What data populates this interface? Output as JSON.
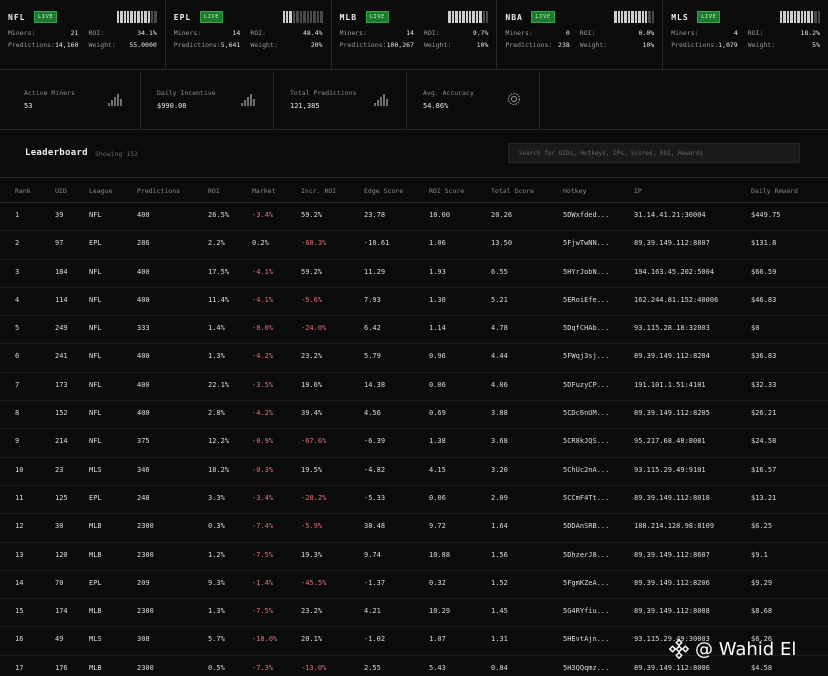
{
  "leagues": [
    {
      "name": "NFL",
      "live": "LIVE",
      "bars_filled": 10,
      "miners_label": "Miners:",
      "miners": "21",
      "roi_label": "ROI:",
      "roi": "34.1%",
      "pred_label": "Predictions:",
      "predictions": "14,160",
      "weight_label": "Weight:",
      "weight": "55.0000"
    },
    {
      "name": "EPL",
      "live": "LIVE",
      "bars_filled": 3,
      "miners_label": "Miners:",
      "miners": "14",
      "roi_label": "ROI:",
      "roi": "48.4%",
      "pred_label": "Predictions:",
      "predictions": "5,641",
      "weight_label": "Weight:",
      "weight": "20%"
    },
    {
      "name": "MLB",
      "live": "LIVE",
      "bars_filled": 10,
      "miners_label": "Miners:",
      "miners": "14",
      "roi_label": "ROI:",
      "roi": "9.7%",
      "pred_label": "Predictions:",
      "predictions": "100,267",
      "weight_label": "Weight:",
      "weight": "10%"
    },
    {
      "name": "NBA",
      "live": "LIVE",
      "bars_filled": 10,
      "miners_label": "Miners:",
      "miners": "0",
      "roi_label": "ROI:",
      "roi": "0.0%",
      "pred_label": "Predictions:",
      "predictions": "238",
      "weight_label": "Weight:",
      "weight": "10%"
    },
    {
      "name": "MLS",
      "live": "LIVE",
      "bars_filled": 10,
      "miners_label": "Miners:",
      "miners": "4",
      "roi_label": "ROI:",
      "roi": "18.2%",
      "pred_label": "Predictions:",
      "predictions": "1,079",
      "weight_label": "Weight:",
      "weight": "5%"
    }
  ],
  "summary": [
    {
      "label": "Active Miners",
      "value": "53",
      "icon": "bar-chart-icon"
    },
    {
      "label": "Daily Incentive",
      "value": "$990.08",
      "icon": "bar-chart-icon"
    },
    {
      "label": "Total Predictions",
      "value": "121,385",
      "icon": "bar-chart-icon"
    },
    {
      "label": "Avg. Accuracy",
      "value": "54.86%",
      "icon": "target-icon"
    }
  ],
  "leaderboard": {
    "title": "Leaderboard",
    "showing": "Showing 152",
    "search_placeholder": "Search for UIDs, Hotkeys, IPs, Scores, ROI, Rewards",
    "columns": [
      "Rank",
      "UID",
      "League",
      "Predictions",
      "ROI",
      "Market",
      "Incr. ROI",
      "Edge Score",
      "ROI Score",
      "Total Score",
      "Hotkey",
      "IP",
      "Daily Reward"
    ],
    "rows": [
      [
        "1",
        "39",
        "NFL",
        "400",
        "26.5%",
        "-3.4%",
        "59.2%",
        "23.78",
        "10.00",
        "20.26",
        "5DWxfded...",
        "31.14.41.21:30004",
        "$449.75"
      ],
      [
        "2",
        "97",
        "EPL",
        "286",
        "2.2%",
        "0.2%",
        "-68.3%",
        "-10.61",
        "1.06",
        "13.50",
        "5FjwTwNN...",
        "89.39.149.112:8807",
        "$131.8"
      ],
      [
        "3",
        "184",
        "NFL",
        "400",
        "17.5%",
        "-4.1%",
        "59.2%",
        "11.29",
        "1.93",
        "6.55",
        "5HYrJobN...",
        "194.163.45.202:5004",
        "$66.59"
      ],
      [
        "4",
        "114",
        "NFL",
        "400",
        "11.4%",
        "-4.1%",
        "-5.6%",
        "7.93",
        "1.30",
        "5.21",
        "5ERoiEfe...",
        "162.244.81.152:40006",
        "$46.83"
      ],
      [
        "5",
        "249",
        "NFL",
        "333",
        "1.4%",
        "-8.0%",
        "-24.0%",
        "6.42",
        "1.14",
        "4.78",
        "5DqfCHAb...",
        "93.115.28.18:32003",
        "$0"
      ],
      [
        "6",
        "241",
        "NFL",
        "400",
        "1.3%",
        "-4.2%",
        "23.2%",
        "5.79",
        "0.96",
        "4.44",
        "5FWqj3sj...",
        "89.39.149.112:8204",
        "$36.83"
      ],
      [
        "7",
        "173",
        "NFL",
        "400",
        "22.1%",
        "-3.5%",
        "19.6%",
        "14.38",
        "0.06",
        "4.06",
        "5DFuzyCP...",
        "191.101.1.51:4101",
        "$32.33"
      ],
      [
        "8",
        "152",
        "NFL",
        "400",
        "2.8%",
        "-4.2%",
        "39.4%",
        "4.56",
        "0.69",
        "3.88",
        "5CDc6nUM...",
        "89.39.149.112:8205",
        "$26.21"
      ],
      [
        "9",
        "214",
        "NFL",
        "375",
        "12.2%",
        "-0.9%",
        "-67.6%",
        "-6.39",
        "1.38",
        "3.68",
        "5CR8kJQS...",
        "95.217.68.48:8081",
        "$24.58"
      ],
      [
        "10",
        "23",
        "MLS",
        "346",
        "18.2%",
        "-0.3%",
        "19.5%",
        "-4.82",
        "4.15",
        "3.20",
        "5ChUc2nA...",
        "93.115.29.49:9101",
        "$16.57"
      ],
      [
        "11",
        "125",
        "EPL",
        "248",
        "3.3%",
        "-3.4%",
        "-28.2%",
        "-5.33",
        "0.06",
        "2.09",
        "5CCmF4Tt...",
        "89.39.149.112:8018",
        "$13.21"
      ],
      [
        "12",
        "30",
        "MLB",
        "2300",
        "0.3%",
        "-7.4%",
        "-5.9%",
        "38.48",
        "9.72",
        "1.64",
        "5DDAnSRB...",
        "188.214.128.98:8109",
        "$6.25"
      ],
      [
        "13",
        "120",
        "MLB",
        "2300",
        "1.2%",
        "-7.5%",
        "19.3%",
        "9.74",
        "10.88",
        "1.56",
        "5DhzerJ8...",
        "89.39.149.112:8607",
        "$9.1"
      ],
      [
        "14",
        "70",
        "EPL",
        "209",
        "9.3%",
        "-1.4%",
        "-45.5%",
        "-1.37",
        "0.32",
        "1.52",
        "5FgmKZeA...",
        "89.39.149.112:8206",
        "$9.29"
      ],
      [
        "15",
        "174",
        "MLB",
        "2300",
        "1.3%",
        "-7.5%",
        "23.2%",
        "4.21",
        "10.29",
        "1.45",
        "5G4RYfiu...",
        "89.39.149.112:8008",
        "$8.68"
      ],
      [
        "16",
        "49",
        "MLS",
        "308",
        "5.7%",
        "-18.0%",
        "20.1%",
        "-1.02",
        "1.07",
        "1.31",
        "5HEvtAjn...",
        "93.115.29.49:30003",
        "$6.26"
      ],
      [
        "17",
        "176",
        "MLB",
        "2300",
        "0.5%",
        "-7.3%",
        "-13.0%",
        "2.55",
        "5.43",
        "0.84",
        "5H3QQqmz...",
        "89.39.149.112:8006",
        "$4.58"
      ]
    ]
  },
  "watermark": {
    "text": "@ Wahid El"
  },
  "colors": {
    "background": "#0b0b0b",
    "live_badge": "#1f7a2e",
    "negative": "#e0707a",
    "border": "#2a2a2a"
  }
}
